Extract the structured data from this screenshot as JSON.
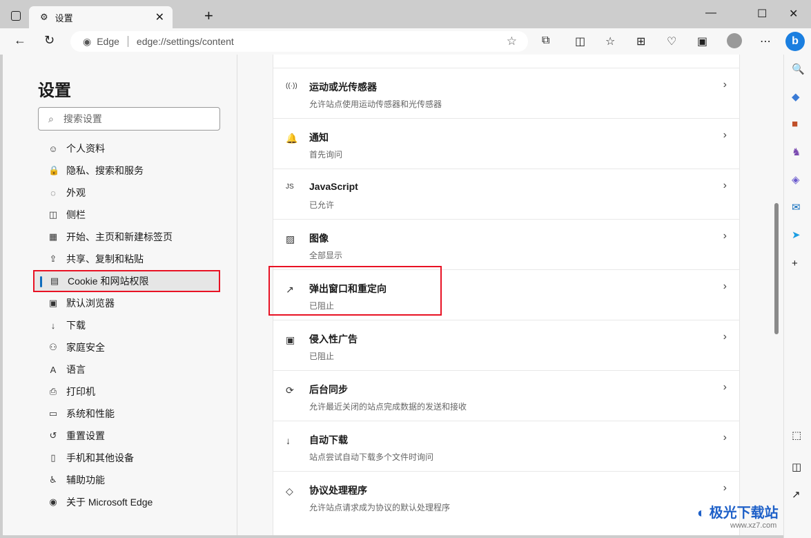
{
  "tab": {
    "title": "设置"
  },
  "address": {
    "site": "Edge",
    "url": "edge://settings/content"
  },
  "settings": {
    "title": "设置",
    "search_placeholder": "搜索设置",
    "nav": [
      {
        "label": "个人资料",
        "icon": "profile-icon"
      },
      {
        "label": "隐私、搜索和服务",
        "icon": "lock-icon"
      },
      {
        "label": "外观",
        "icon": "palette-icon"
      },
      {
        "label": "侧栏",
        "icon": "sidebar-icon"
      },
      {
        "label": "开始、主页和新建标签页",
        "icon": "home-icon"
      },
      {
        "label": "共享、复制和粘贴",
        "icon": "share-icon"
      },
      {
        "label": "Cookie 和网站权限",
        "icon": "cookie-icon",
        "active": true
      },
      {
        "label": "默认浏览器",
        "icon": "browser-icon"
      },
      {
        "label": "下载",
        "icon": "download-icon"
      },
      {
        "label": "家庭安全",
        "icon": "family-icon"
      },
      {
        "label": "语言",
        "icon": "language-icon"
      },
      {
        "label": "打印机",
        "icon": "printer-icon"
      },
      {
        "label": "系统和性能",
        "icon": "laptop-icon"
      },
      {
        "label": "重置设置",
        "icon": "reset-icon"
      },
      {
        "label": "手机和其他设备",
        "icon": "phone-icon"
      },
      {
        "label": "辅助功能",
        "icon": "accessibility-icon"
      },
      {
        "label": "关于 Microsoft Edge",
        "icon": "edge-icon"
      }
    ]
  },
  "permissions": [
    {
      "title": "运动或光传感器",
      "sub": "允许站点使用运动传感器和光传感器",
      "icon": "sensor-icon"
    },
    {
      "title": "通知",
      "sub": "首先询问",
      "icon": "bell-icon"
    },
    {
      "title": "JavaScript",
      "sub": "已允许",
      "icon": "js-icon"
    },
    {
      "title": "图像",
      "sub": "全部显示",
      "icon": "image-icon"
    },
    {
      "title": "弹出窗口和重定向",
      "sub": "已阻止",
      "icon": "popup-icon"
    },
    {
      "title": "侵入性广告",
      "sub": "已阻止",
      "icon": "ads-icon"
    },
    {
      "title": "后台同步",
      "sub": "允许最近关闭的站点完成数据的发送和接收",
      "icon": "sync-icon"
    },
    {
      "title": "自动下载",
      "sub": "站点尝试自动下载多个文件时询问",
      "icon": "download-icon"
    },
    {
      "title": "协议处理程序",
      "sub": "允许站点请求成为协议的默认处理程序",
      "icon": "protocol-icon"
    }
  ],
  "watermark": {
    "name": "极光下载站",
    "url": "www.xz7.com"
  },
  "colors": {
    "highlight": "#e81123",
    "accent": "#0f6cbd"
  }
}
